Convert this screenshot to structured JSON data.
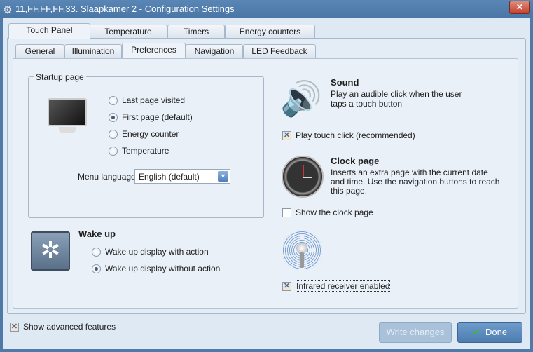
{
  "window": {
    "title": "11,FF,FF,FF,33. Slaapkamer 2 - Configuration Settings",
    "close": "✕"
  },
  "outer_tabs": [
    "Touch Panel",
    "Temperature",
    "Timers",
    "Energy counters"
  ],
  "inner_tabs": [
    "General",
    "Illumination",
    "Preferences",
    "Navigation",
    "LED Feedback"
  ],
  "startup": {
    "label": "Startup page",
    "options": [
      "Last page visited",
      "First page (default)",
      "Energy counter",
      "Temperature"
    ],
    "selected": 1,
    "menu_language_label": "Menu language:",
    "menu_language": "English (default)"
  },
  "wakeup": {
    "title": "Wake up",
    "options": [
      "Wake up display with action",
      "Wake up display without action"
    ],
    "selected": 1
  },
  "sound": {
    "title": "Sound",
    "desc1": "Play an audible click when the user",
    "desc2": "taps a touch button",
    "checkbox": "Play touch click (recommended)",
    "checked": true
  },
  "clock": {
    "title": "Clock page",
    "desc1": "Inserts an extra page with the current date",
    "desc2": "and time. Use the navigation buttons to reach",
    "desc3": "this page.",
    "checkbox": "Show the clock page",
    "checked": false
  },
  "infrared": {
    "checkbox": "Infrared receiver enabled",
    "checked": true
  },
  "footer": {
    "advanced": "Show advanced features",
    "write": "Write changes",
    "done": "Done"
  }
}
